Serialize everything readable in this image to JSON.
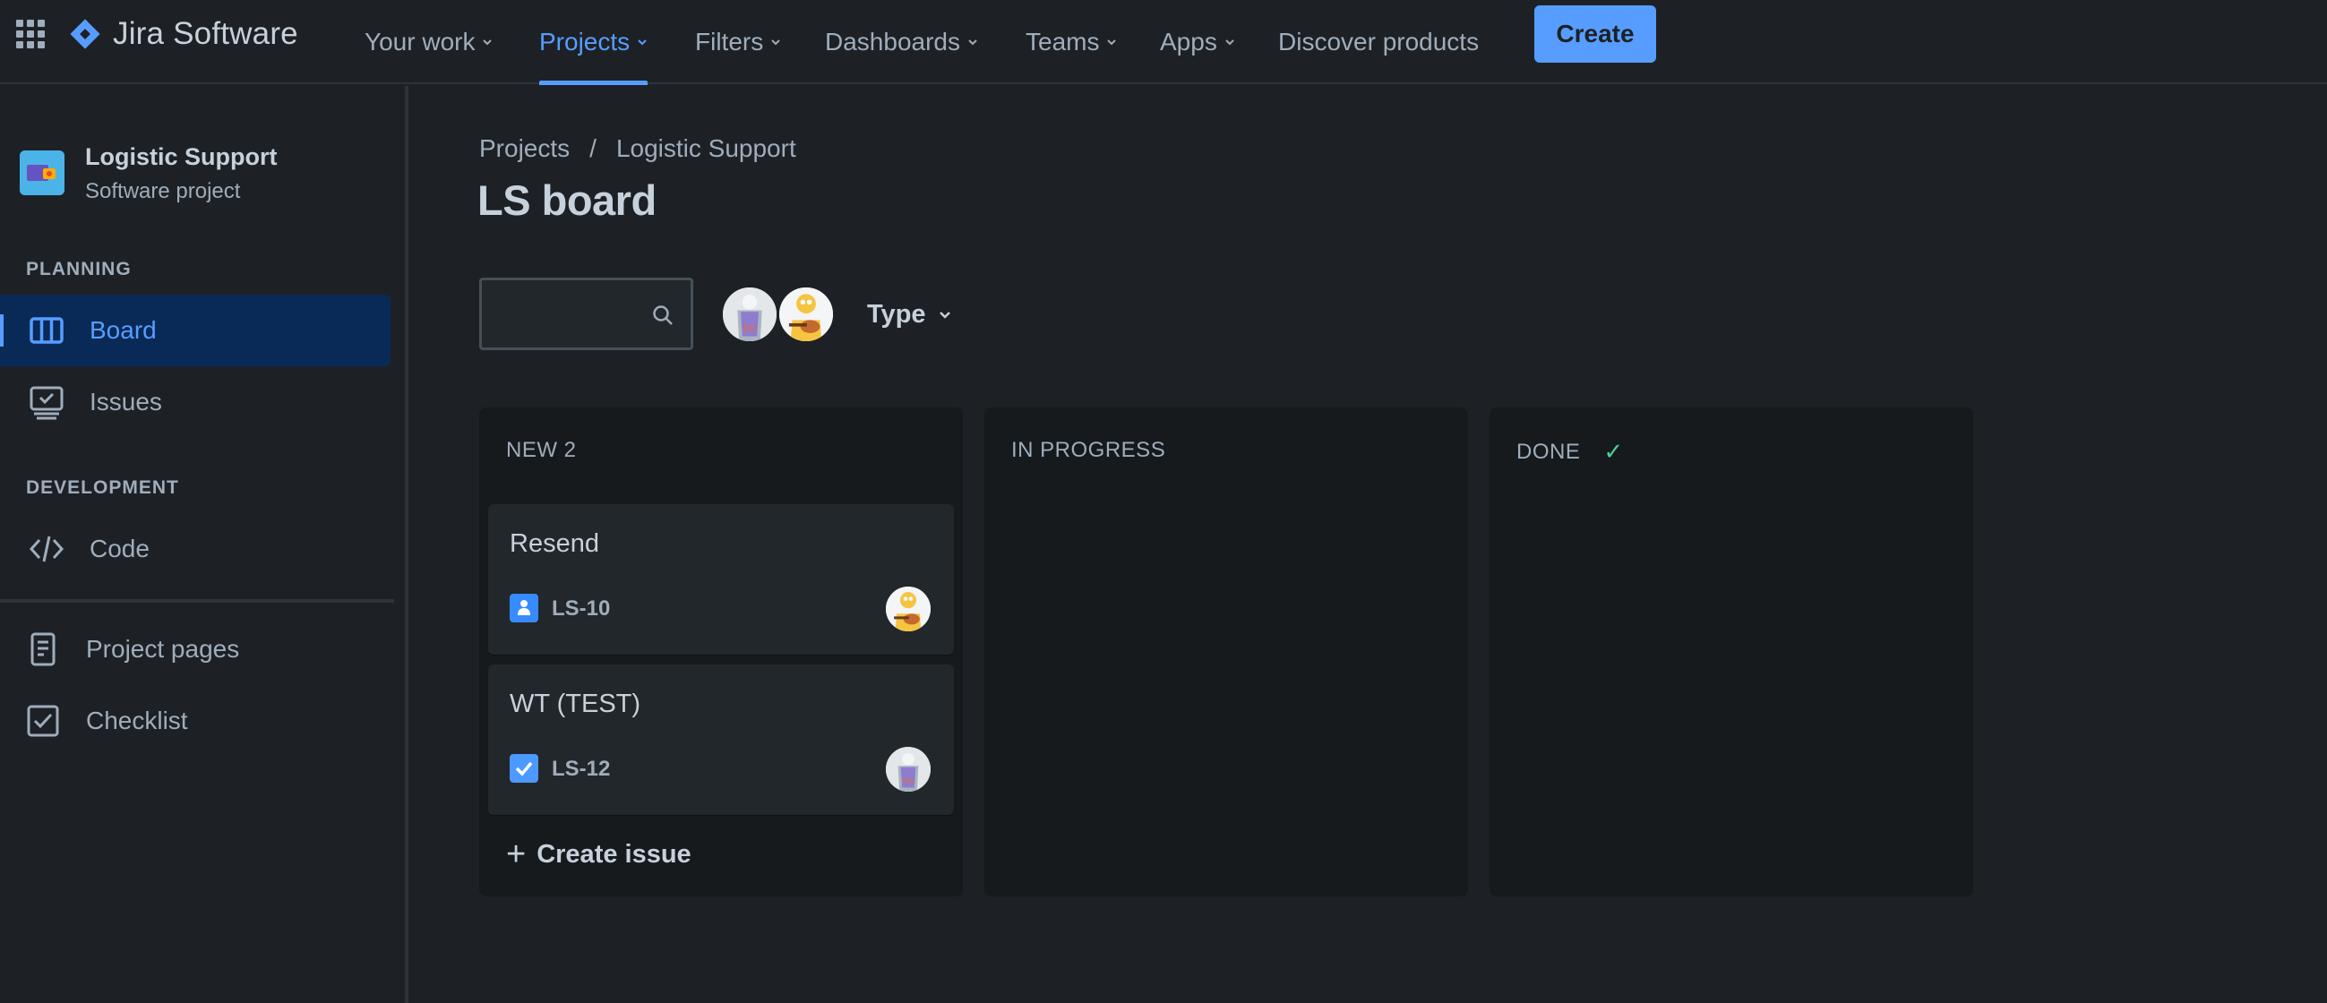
{
  "topnav": {
    "product_name": "Jira Software",
    "items": [
      {
        "label": "Your work",
        "has_chevron": true
      },
      {
        "label": "Projects",
        "has_chevron": true,
        "active": true
      },
      {
        "label": "Filters",
        "has_chevron": true
      },
      {
        "label": "Dashboards",
        "has_chevron": true
      },
      {
        "label": "Teams",
        "has_chevron": true
      },
      {
        "label": "Apps",
        "has_chevron": true
      },
      {
        "label": "Discover products",
        "has_chevron": false
      }
    ],
    "create_label": "Create"
  },
  "sidebar": {
    "project_name": "Logistic Support",
    "project_type": "Software project",
    "planning_title": "PLANNING",
    "planning_items": [
      {
        "label": "Board",
        "icon": "board-icon",
        "active": true
      },
      {
        "label": "Issues",
        "icon": "issues-icon"
      }
    ],
    "development_title": "DEVELOPMENT",
    "development_items": [
      {
        "label": "Code",
        "icon": "code-icon"
      }
    ],
    "page_items": [
      {
        "label": "Project pages",
        "icon": "page-icon"
      },
      {
        "label": "Checklist",
        "icon": "checklist-icon"
      }
    ]
  },
  "main": {
    "breadcrumb": [
      "Projects",
      "Logistic Support"
    ],
    "breadcrumb_sep": "/",
    "title": "LS board",
    "search_placeholder": "",
    "type_filter_label": "Type",
    "columns": [
      {
        "title": "NEW 2",
        "cards": [
          {
            "title": "Resend",
            "key": "LS-10",
            "type": "story",
            "assignee": "guitar-avatar"
          },
          {
            "title": "WT (TEST)",
            "key": "LS-12",
            "type": "task",
            "assignee": "jersey-avatar"
          }
        ],
        "create_label": "Create issue"
      },
      {
        "title": "IN PROGRESS",
        "cards": []
      },
      {
        "title": "DONE",
        "done_check": "✓",
        "cards": []
      }
    ]
  },
  "colors": {
    "accent": "#579dff",
    "background": "#1d2125",
    "column_bg": "#161a1d",
    "card_bg": "#22272b",
    "done_check": "#4bce97"
  }
}
